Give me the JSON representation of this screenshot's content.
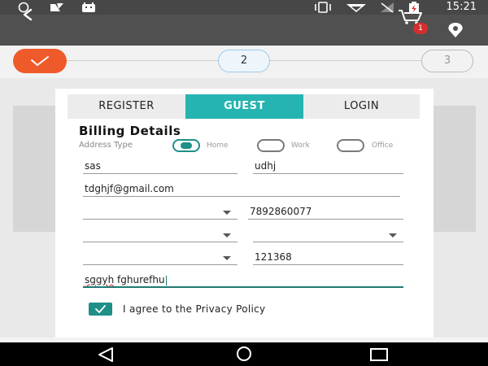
{
  "status_bar": {
    "time": "15:21",
    "icons": [
      "circle-icon",
      "mail-icon",
      "android-icon",
      "vibrate-icon",
      "wifi-icon",
      "no-signal-icon",
      "battery-charging-icon"
    ]
  },
  "app_bar": {
    "cart_count": "1"
  },
  "stepper": {
    "current_step": "2",
    "next_step": "3"
  },
  "tabs": [
    "REGISTER",
    "GUEST",
    "LOGIN"
  ],
  "billing": {
    "title": "Billing Details",
    "address_type_label": "Address Type",
    "address_types": [
      "Home",
      "Work",
      "Office"
    ],
    "selected_address_type": "Home",
    "first_name": "sas",
    "last_name": "udhj",
    "email": "tdghjf@gmail.com",
    "phone": "7892860077",
    "pincode": "121368",
    "address_misspelled": "sggyh",
    "address_rest": " fghurefhu"
  },
  "agree": {
    "label": "I agree to the Privacy Policy",
    "checked": true
  },
  "colors": {
    "accent": "#25b4b1",
    "step_done": "#ef5a2a",
    "checkbox": "#1f8f87",
    "cart_badge": "#d32f2f"
  }
}
